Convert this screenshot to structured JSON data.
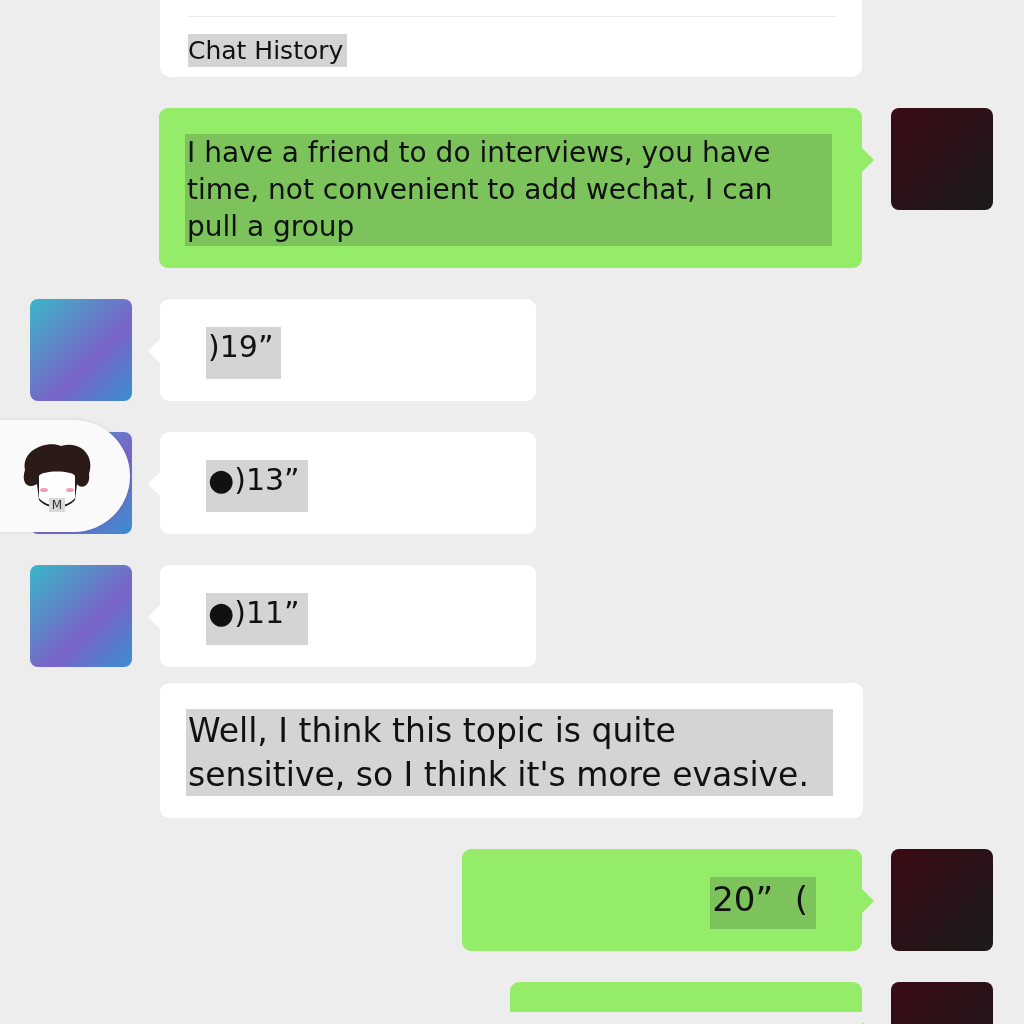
{
  "top_card": {
    "label": "Chat History"
  },
  "messages": [
    {
      "kind": "sent_text",
      "text": "I have a friend to do interviews, you have time, not convenient to add wechat, I can pull a group"
    },
    {
      "kind": "received_voice",
      "text": ")19”"
    },
    {
      "kind": "received_voice",
      "text": "●)13”"
    },
    {
      "kind": "received_voice",
      "text": "●)11”"
    },
    {
      "kind": "plain_text",
      "text": "Well, I think this topic is quite sensitive, so I think it's more evasive."
    },
    {
      "kind": "sent_voice",
      "text": "20”  ("
    },
    {
      "kind": "sent_partial"
    }
  ],
  "floating_widget": {
    "label": "M"
  }
}
